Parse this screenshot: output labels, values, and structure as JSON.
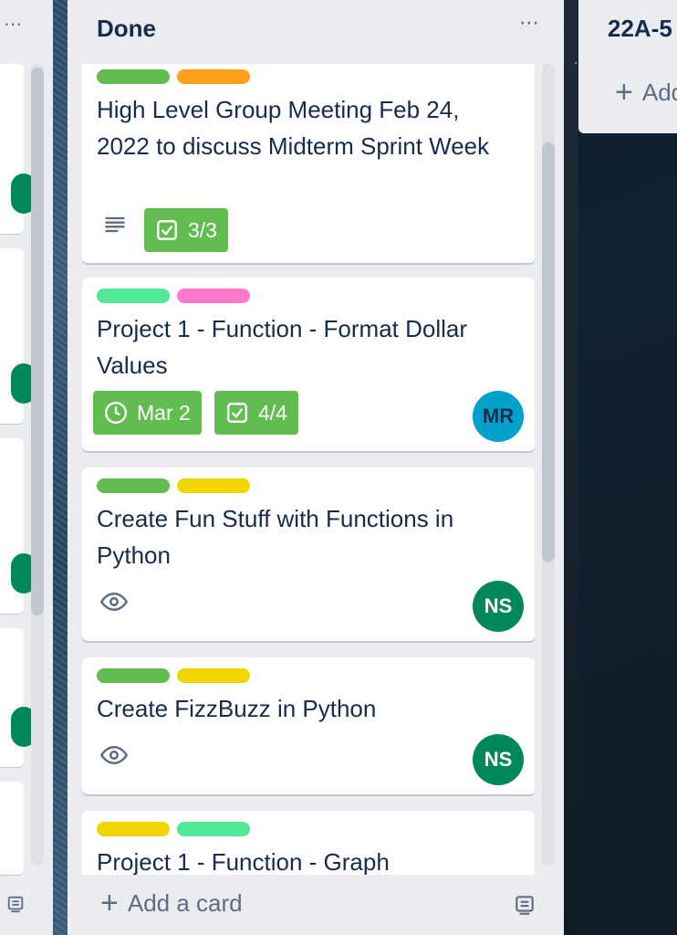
{
  "left_list": {
    "menu_icon": "more-horizontal-icon",
    "footer_icon": "card-template-icon"
  },
  "done_list": {
    "title": "Done",
    "menu_icon": "more-horizontal-icon",
    "add_card_label": "Add a card",
    "cards": [
      {
        "title": "High Level Group Meeting Feb 24, 2022 to discuss Midterm Sprint Week",
        "labels": [
          "#61bd4f",
          "#ff9f1a"
        ],
        "has_description": true,
        "checklist": "3/3"
      },
      {
        "title": "Project 1 - Function - Format Dollar Values",
        "labels": [
          "#51e898",
          "#ff78cb"
        ],
        "due": "Mar 2",
        "checklist": "4/4",
        "member": "MR",
        "member_color": "#00a2c9"
      },
      {
        "title": "Create Fun Stuff with Functions in Python",
        "labels": [
          "#61bd4f",
          "#f2d600"
        ],
        "watching": true,
        "member": "NS",
        "member_color": "#00875a"
      },
      {
        "title": "Create FizzBuzz in Python",
        "labels": [
          "#61bd4f",
          "#f2d600"
        ],
        "watching": true,
        "member": "NS",
        "member_color": "#00875a"
      },
      {
        "title": "Project 1 - Function - Graph",
        "labels": [
          "#f2d600",
          "#51e898"
        ]
      }
    ]
  },
  "right_list": {
    "title": "22A-5",
    "add_label": "Add"
  }
}
